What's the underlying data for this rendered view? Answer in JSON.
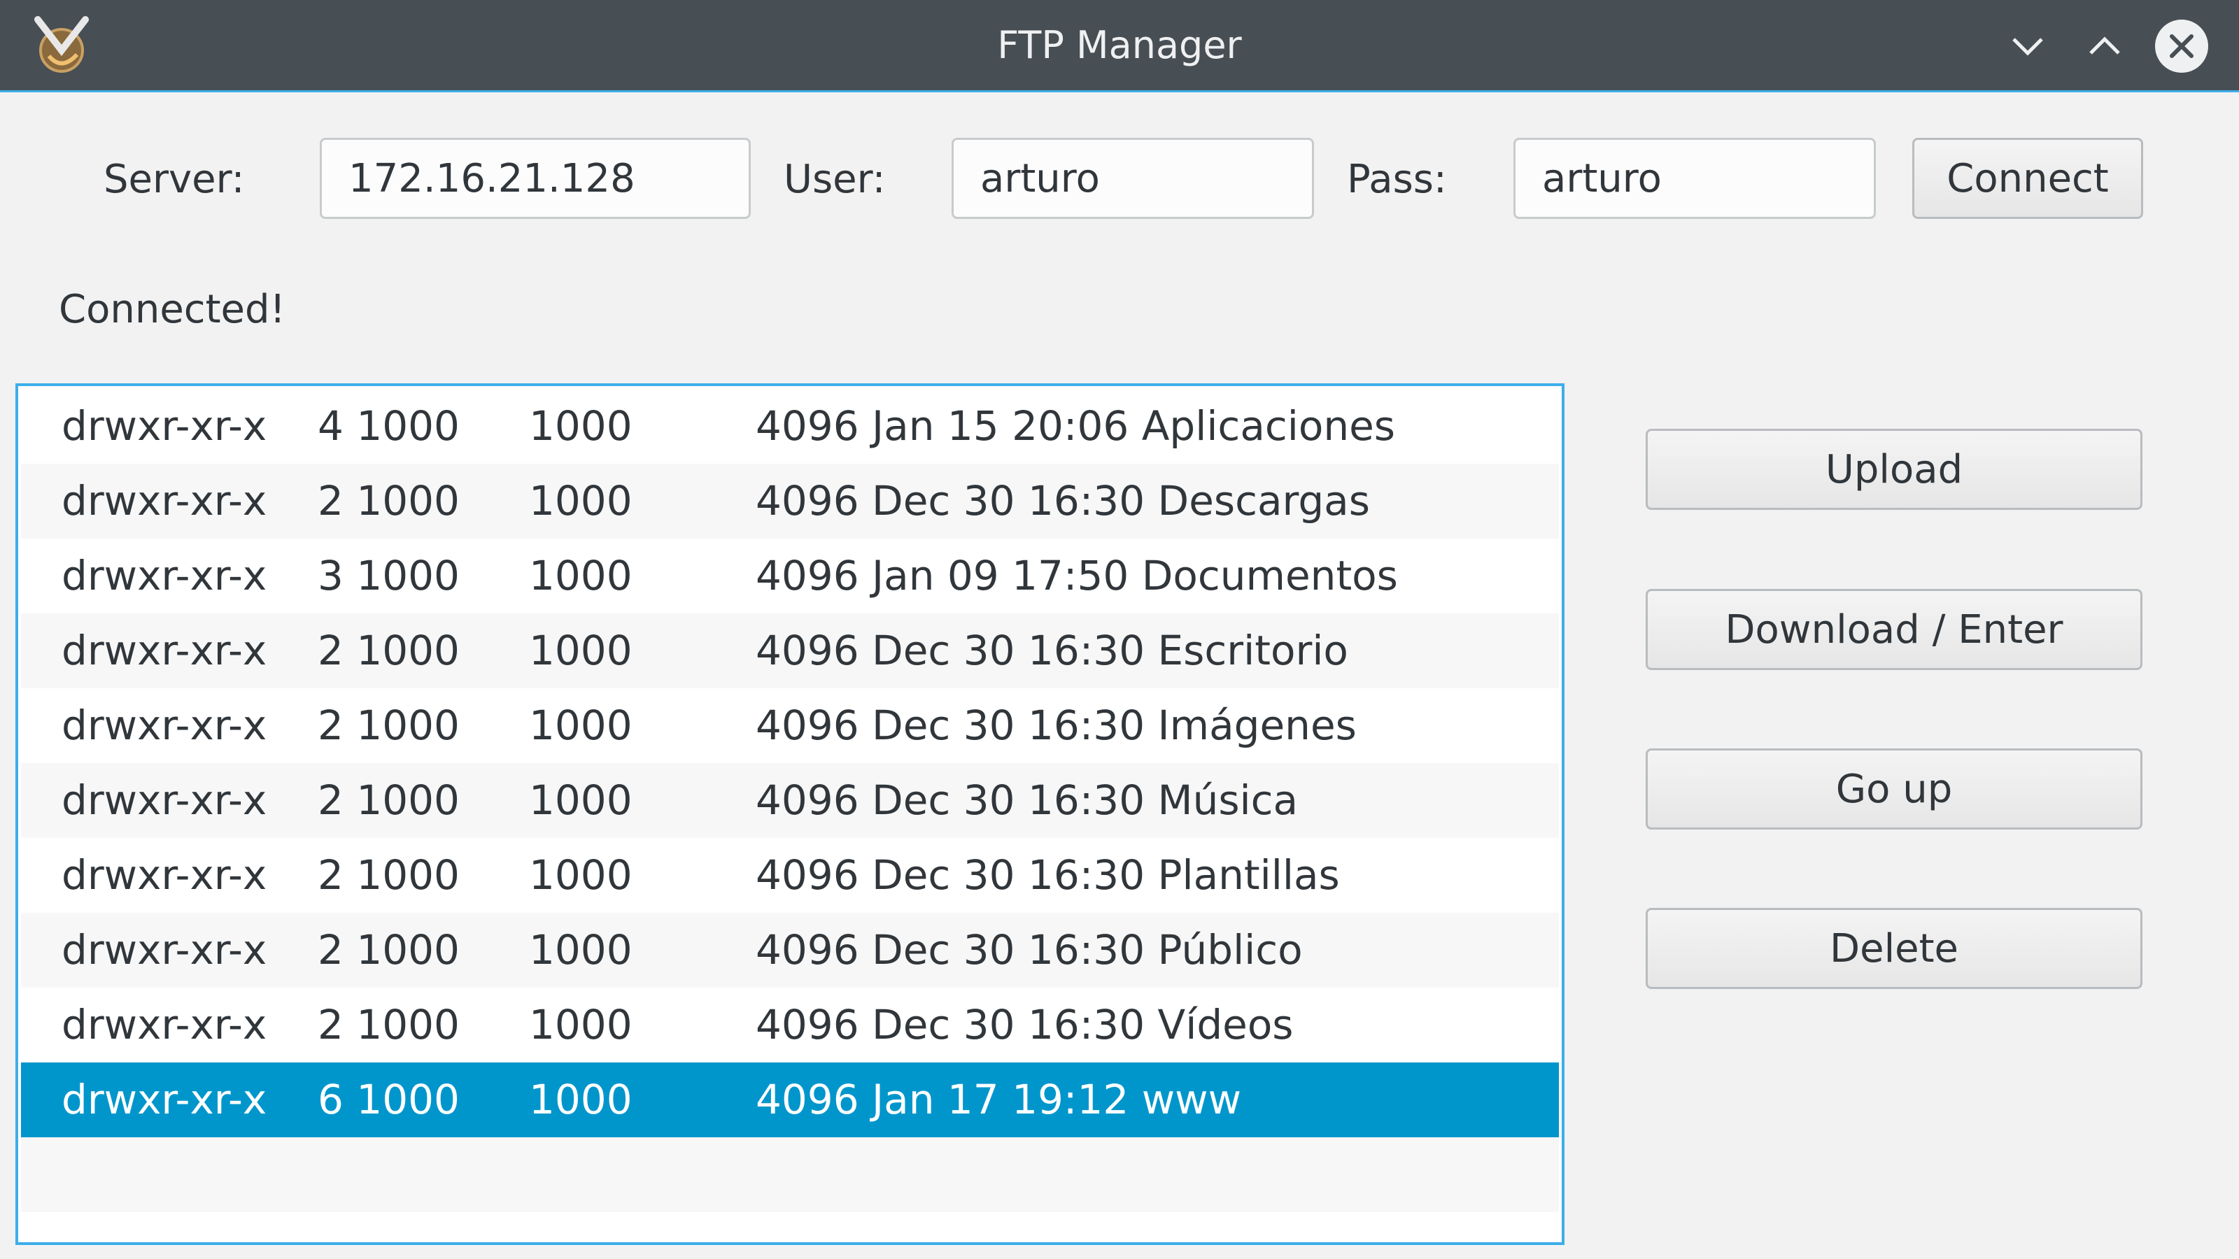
{
  "window": {
    "title": "FTP Manager"
  },
  "connection": {
    "server_label": "Server:",
    "server_value": "172.16.21.128",
    "user_label": "User:",
    "user_value": "arturo",
    "pass_label": "Pass:",
    "pass_value": "arturo",
    "connect_label": "Connect"
  },
  "status": "Connected!",
  "files": [
    {
      "perm": "drwxr-xr-x",
      "links": "4 1000",
      "group": "1000",
      "rest": "4096 Jan 15 20:06 Aplicaciones"
    },
    {
      "perm": "drwxr-xr-x",
      "links": "2 1000",
      "group": "1000",
      "rest": "4096 Dec 30 16:30 Descargas"
    },
    {
      "perm": "drwxr-xr-x",
      "links": "3 1000",
      "group": "1000",
      "rest": "4096 Jan 09 17:50 Documentos"
    },
    {
      "perm": "drwxr-xr-x",
      "links": "2 1000",
      "group": "1000",
      "rest": "4096 Dec 30 16:30 Escritorio"
    },
    {
      "perm": "drwxr-xr-x",
      "links": "2 1000",
      "group": "1000",
      "rest": "4096 Dec 30 16:30 Imágenes"
    },
    {
      "perm": "drwxr-xr-x",
      "links": "2 1000",
      "group": "1000",
      "rest": "4096 Dec 30 16:30 Música"
    },
    {
      "perm": "drwxr-xr-x",
      "links": "2 1000",
      "group": "1000",
      "rest": "4096 Dec 30 16:30 Plantillas"
    },
    {
      "perm": "drwxr-xr-x",
      "links": "2 1000",
      "group": "1000",
      "rest": "4096 Dec 30 16:30 Público"
    },
    {
      "perm": "drwxr-xr-x",
      "links": "2 1000",
      "group": "1000",
      "rest": "4096 Dec 30 16:30 Vídeos"
    },
    {
      "perm": "drwxr-xr-x",
      "links": "6 1000",
      "group": "1000",
      "rest": "4096 Jan 17 19:12 www",
      "selected": true
    }
  ],
  "actions": {
    "upload": "Upload",
    "download": "Download / Enter",
    "go_up": "Go up",
    "delete": "Delete"
  },
  "colors": {
    "titlebar": "#474e54",
    "accent": "#3daee9",
    "selection": "#0096cc"
  },
  "icons": {
    "app": "app-icon",
    "minimize": "chevron-down-icon",
    "maximize": "chevron-up-icon",
    "close": "close-icon"
  }
}
